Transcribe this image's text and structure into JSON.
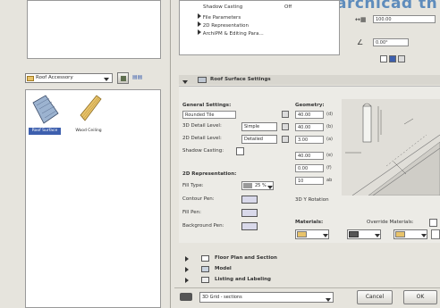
{
  "watermark": "archicad th",
  "left_panel": {
    "dropdown_label": "Roof Accessory",
    "items": [
      {
        "label": "Roof Surface",
        "selected": true
      },
      {
        "label": "Wood Ceiling",
        "selected": false
      }
    ]
  },
  "top_tree": {
    "items": [
      {
        "label": "Shadow Casting",
        "value": "Off"
      },
      {
        "label": "File Parameters"
      },
      {
        "label": "2D Representation"
      },
      {
        "label": "ArchiPM & Editing Para..."
      }
    ]
  },
  "top_right": {
    "height_value": "100.00",
    "angle_value": "0.00°"
  },
  "settings_header": "Roof Surface Settings",
  "general": {
    "title": "General Settings:",
    "type_label": "Rounded Tile",
    "detail_level_1_label": "3D Detail Level:",
    "detail_level_1_value": "Simple",
    "detail_level_2_label": "2D Detail Level:",
    "detail_level_2_value": "Detailed",
    "shadow_label": "Shadow Casting:"
  },
  "geometry": {
    "title": "Geometry:",
    "rows": [
      {
        "value": "40.00",
        "unit": "(d)"
      },
      {
        "value": "40.00",
        "unit": "(b)"
      },
      {
        "value": "3.00",
        "unit": "(a)"
      },
      {
        "value": "40.00",
        "unit": "(e)"
      },
      {
        "value": "0.00",
        "unit": "(f)"
      },
      {
        "value": "10",
        "unit": "ab"
      }
    ]
  },
  "rep2d": {
    "title": "2D Representation:",
    "fill_type_label": "Fill Type:",
    "fill_type_value": "25 %",
    "contour_pen_label": "Contour Pen:",
    "fill_pen_label": "Fill Pen:",
    "background_pen_label": "Background Pen:"
  },
  "preview_caption": "3D Y Rotation",
  "materials": {
    "label": "Materials:",
    "override_label": "Override Materials:"
  },
  "collapsed_sections": [
    "Floor Plan and Section",
    "Model",
    "Listing and Labeling"
  ],
  "footer": {
    "layer_value": "3D Grid - sections",
    "cancel": "Cancel",
    "ok": "OK"
  },
  "colors": {
    "accent": "#3d5fae",
    "panel": "#e6e4dd",
    "roof_blue": "#9cb3d0",
    "wood_yellow": "#e8c36a"
  }
}
